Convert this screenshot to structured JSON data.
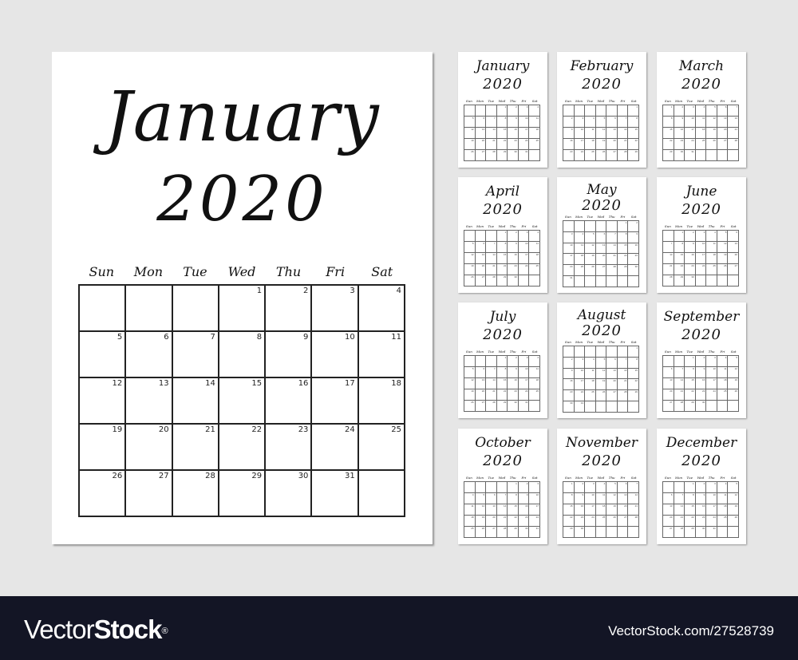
{
  "main_calendar": {
    "month": "January",
    "year": "2020",
    "weekdays": [
      "Sun",
      "Mon",
      "Tue",
      "Wed",
      "Thu",
      "Fri",
      "Sat"
    ],
    "first_weekday_index": 3,
    "days_in_month": 31,
    "rows": 5
  },
  "mini_calendars": [
    {
      "month": "January",
      "year": "2020",
      "first_weekday_index": 3,
      "days_in_month": 31,
      "rows": 5
    },
    {
      "month": "February",
      "year": "2020",
      "first_weekday_index": 6,
      "days_in_month": 29,
      "rows": 5
    },
    {
      "month": "March",
      "year": "2020",
      "first_weekday_index": 0,
      "days_in_month": 31,
      "rows": 5
    },
    {
      "month": "April",
      "year": "2020",
      "first_weekday_index": 3,
      "days_in_month": 30,
      "rows": 5
    },
    {
      "month": "May",
      "year": "2020",
      "first_weekday_index": 5,
      "days_in_month": 31,
      "rows": 6
    },
    {
      "month": "June",
      "year": "2020",
      "first_weekday_index": 1,
      "days_in_month": 30,
      "rows": 5
    },
    {
      "month": "July",
      "year": "2020",
      "first_weekday_index": 3,
      "days_in_month": 31,
      "rows": 5
    },
    {
      "month": "August",
      "year": "2020",
      "first_weekday_index": 6,
      "days_in_month": 31,
      "rows": 6
    },
    {
      "month": "September",
      "year": "2020",
      "first_weekday_index": 2,
      "days_in_month": 30,
      "rows": 5
    },
    {
      "month": "October",
      "year": "2020",
      "first_weekday_index": 4,
      "days_in_month": 31,
      "rows": 5
    },
    {
      "month": "November",
      "year": "2020",
      "first_weekday_index": 0,
      "days_in_month": 30,
      "rows": 5
    },
    {
      "month": "December",
      "year": "2020",
      "first_weekday_index": 2,
      "days_in_month": 31,
      "rows": 5
    }
  ],
  "footer": {
    "logo_light": "Vector",
    "logo_bold": "Stock",
    "logo_mark": "®",
    "image_id": "VectorStock.com/27528739"
  },
  "colors": {
    "background": "#e6e6e6",
    "footer": "#131525",
    "ink": "#111111"
  }
}
